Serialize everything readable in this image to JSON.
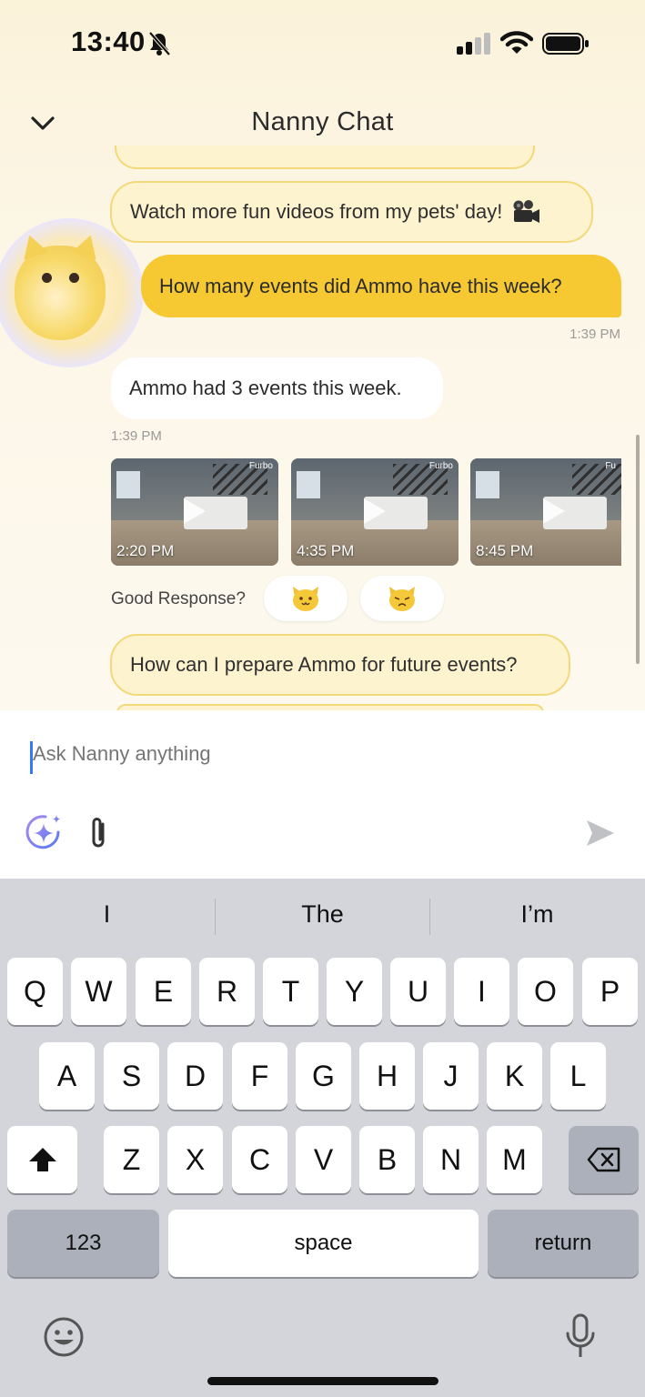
{
  "status_bar": {
    "time": "13:40"
  },
  "header": {
    "title": "Nanny Chat"
  },
  "chat": {
    "suggestion_top": "Watch more fun videos from my pets' day!",
    "user_message": "How many events did Ammo have this week?",
    "user_timestamp": "1:39 PM",
    "bot_message": "Ammo had 3 events this week.",
    "bot_timestamp": "1:39 PM",
    "videos": [
      {
        "time": "2:20 PM",
        "brand": "Furbo"
      },
      {
        "time": "4:35 PM",
        "brand": "Furbo"
      },
      {
        "time": "8:45 PM",
        "brand": "Fu"
      }
    ],
    "feedback_label": "Good Response?",
    "suggestion_bottom": "How can I prepare Ammo for future events?"
  },
  "composer": {
    "placeholder": "Ask Nanny anything"
  },
  "keyboard": {
    "suggestions": [
      "I",
      "The",
      "I’m"
    ],
    "row1": [
      "Q",
      "W",
      "E",
      "R",
      "T",
      "Y",
      "U",
      "I",
      "O",
      "P"
    ],
    "row2": [
      "A",
      "S",
      "D",
      "F",
      "G",
      "H",
      "J",
      "K",
      "L"
    ],
    "row3": [
      "Z",
      "X",
      "C",
      "V",
      "B",
      "N",
      "M"
    ],
    "numbers_label": "123",
    "space_label": "space",
    "return_label": "return"
  },
  "colors": {
    "accent": "#f6c932",
    "suggestion_bg": "#fdf3cf",
    "suggestion_border": "#f2d97a",
    "keyboard_bg": "#d3d5db"
  }
}
